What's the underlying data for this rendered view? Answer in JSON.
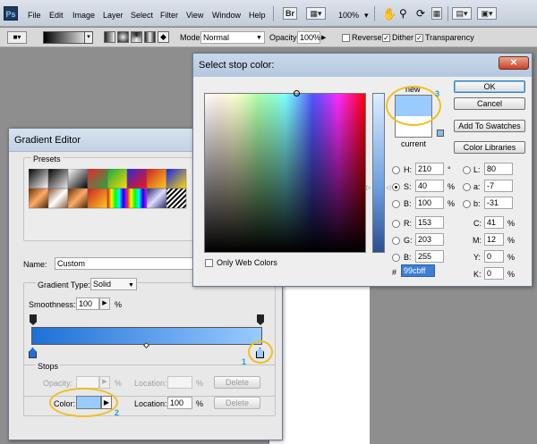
{
  "app": {
    "logo": "Ps"
  },
  "menu": [
    "File",
    "Edit",
    "Image",
    "Layer",
    "Select",
    "Filter",
    "View",
    "Window",
    "Help"
  ],
  "toolbar": {
    "zoom": "100%",
    "br": "Br"
  },
  "options": {
    "mode_label": "Mode:",
    "mode_value": "Normal",
    "opacity_label": "Opacity:",
    "opacity_value": "100%",
    "reverse": "Reverse",
    "dither": "Dither",
    "transparency": "Transparency"
  },
  "gradient_editor": {
    "title": "Gradient Editor",
    "presets_label": "Presets",
    "name_label": "Name:",
    "name_value": "Custom",
    "type_label": "Gradient Type:",
    "type_value": "Solid",
    "smooth_label": "Smoothness:",
    "smooth_value": "100",
    "smooth_unit": "%",
    "stops_label": "Stops",
    "opacity_label": "Opacity:",
    "opacity_unit": "%",
    "location_label": "Location:",
    "location_unit": "%",
    "delete_label": "Delete",
    "color_label": "Color:",
    "color_location_value": "100",
    "callout_1": "1",
    "callout_2": "2",
    "colors": {
      "gradient_start": "#1e6fd6",
      "gradient_end": "#99cbff",
      "swatch": "#99cbff"
    }
  },
  "picker": {
    "title": "Select stop color:",
    "ok": "OK",
    "cancel": "Cancel",
    "add_swatches": "Add To Swatches",
    "libraries": "Color Libraries",
    "new_label": "new",
    "current_label": "current",
    "callout_3": "3",
    "web_colors": "Only Web Colors",
    "fields": {
      "h": {
        "label": "H:",
        "value": "210",
        "unit": "°"
      },
      "s": {
        "label": "S:",
        "value": "40",
        "unit": "%"
      },
      "b": {
        "label": "B:",
        "value": "100",
        "unit": "%"
      },
      "r": {
        "label": "R:",
        "value": "153"
      },
      "g": {
        "label": "G:",
        "value": "203"
      },
      "bl": {
        "label": "B:",
        "value": "255"
      },
      "L": {
        "label": "L:",
        "value": "80"
      },
      "a": {
        "label": "a:",
        "value": "-7"
      },
      "b2": {
        "label": "b:",
        "value": "-31"
      },
      "c": {
        "label": "C:",
        "value": "41",
        "unit": "%"
      },
      "m": {
        "label": "M:",
        "value": "12",
        "unit": "%"
      },
      "y": {
        "label": "Y:",
        "value": "0",
        "unit": "%"
      },
      "k": {
        "label": "K:",
        "value": "0",
        "unit": "%"
      }
    },
    "hex_label": "#",
    "hex_value": "99cbff",
    "colors": {
      "new": "#99cbff",
      "current": "#ffffff"
    }
  }
}
